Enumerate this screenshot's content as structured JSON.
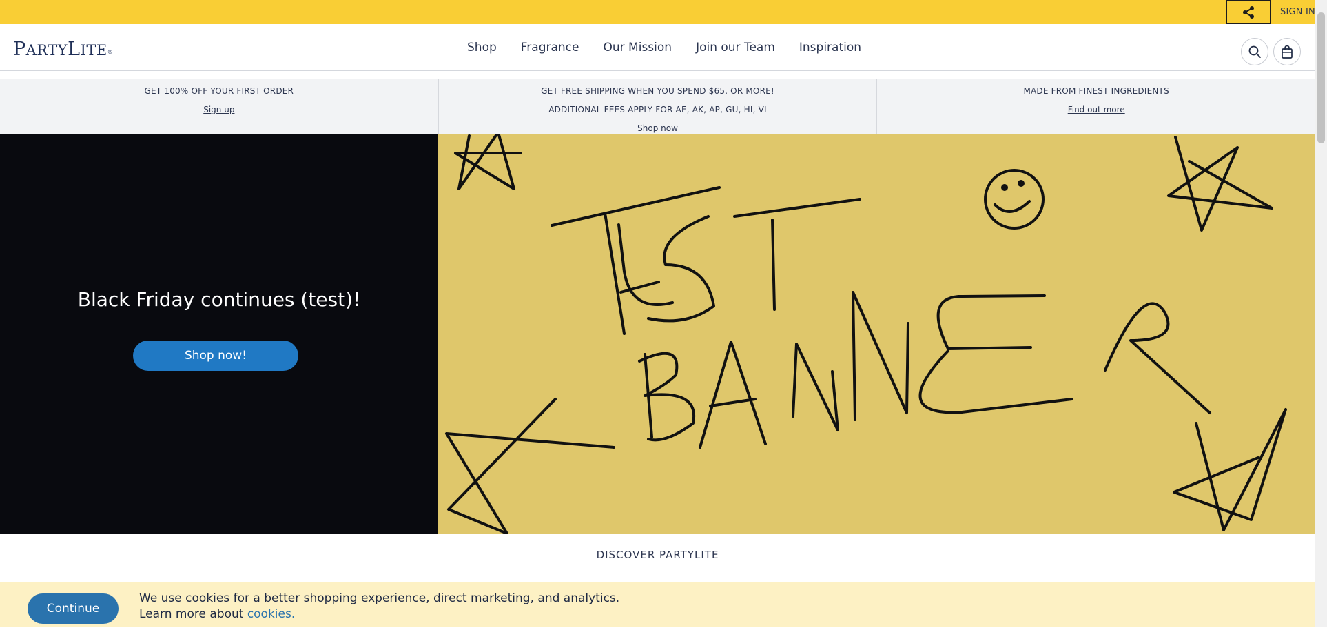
{
  "topbar": {
    "share_icon": "share-icon",
    "signin_label": "SIGN IN"
  },
  "header": {
    "logo": {
      "first": "P",
      "rest": "ARTY",
      "second": "L",
      "rest2": "ITE",
      "mark": "®"
    },
    "nav": [
      {
        "label": "Shop"
      },
      {
        "label": "Fragrance"
      },
      {
        "label": "Our Mission"
      },
      {
        "label": "Join our Team"
      },
      {
        "label": "Inspiration"
      }
    ],
    "search_icon": "search-icon",
    "bag_icon": "shopping-bag-icon"
  },
  "promo": [
    {
      "lines": [
        "GET 100% OFF YOUR FIRST ORDER"
      ],
      "link": "Sign up"
    },
    {
      "lines": [
        "GET FREE SHIPPING WHEN YOU SPEND $65, OR MORE!",
        "ADDITIONAL FEES APPLY FOR AE, AK, AP, GU, HI, VI"
      ],
      "link": "Shop now"
    },
    {
      "lines": [
        "MADE FROM FINEST INGREDIENTS"
      ],
      "link": "Find out more"
    }
  ],
  "hero": {
    "title": "Black Friday continues (test)!",
    "button": "Shop now!",
    "banner_text": [
      "TEST",
      "BANNER"
    ],
    "banner_color": "#dfc76b"
  },
  "discover": {
    "title": "DISCOVER PARTYLITE"
  },
  "cookie": {
    "button": "Continue",
    "line1": "We use cookies for a better shopping experience, direct marketing, and analytics.",
    "line2_prefix": "Learn more about ",
    "link": "cookies."
  },
  "colors": {
    "topbar": "#f9ce35",
    "primary_button": "#2079c4",
    "cookie_bg": "#fdf1c4",
    "hero_dark": "#090a0f"
  }
}
